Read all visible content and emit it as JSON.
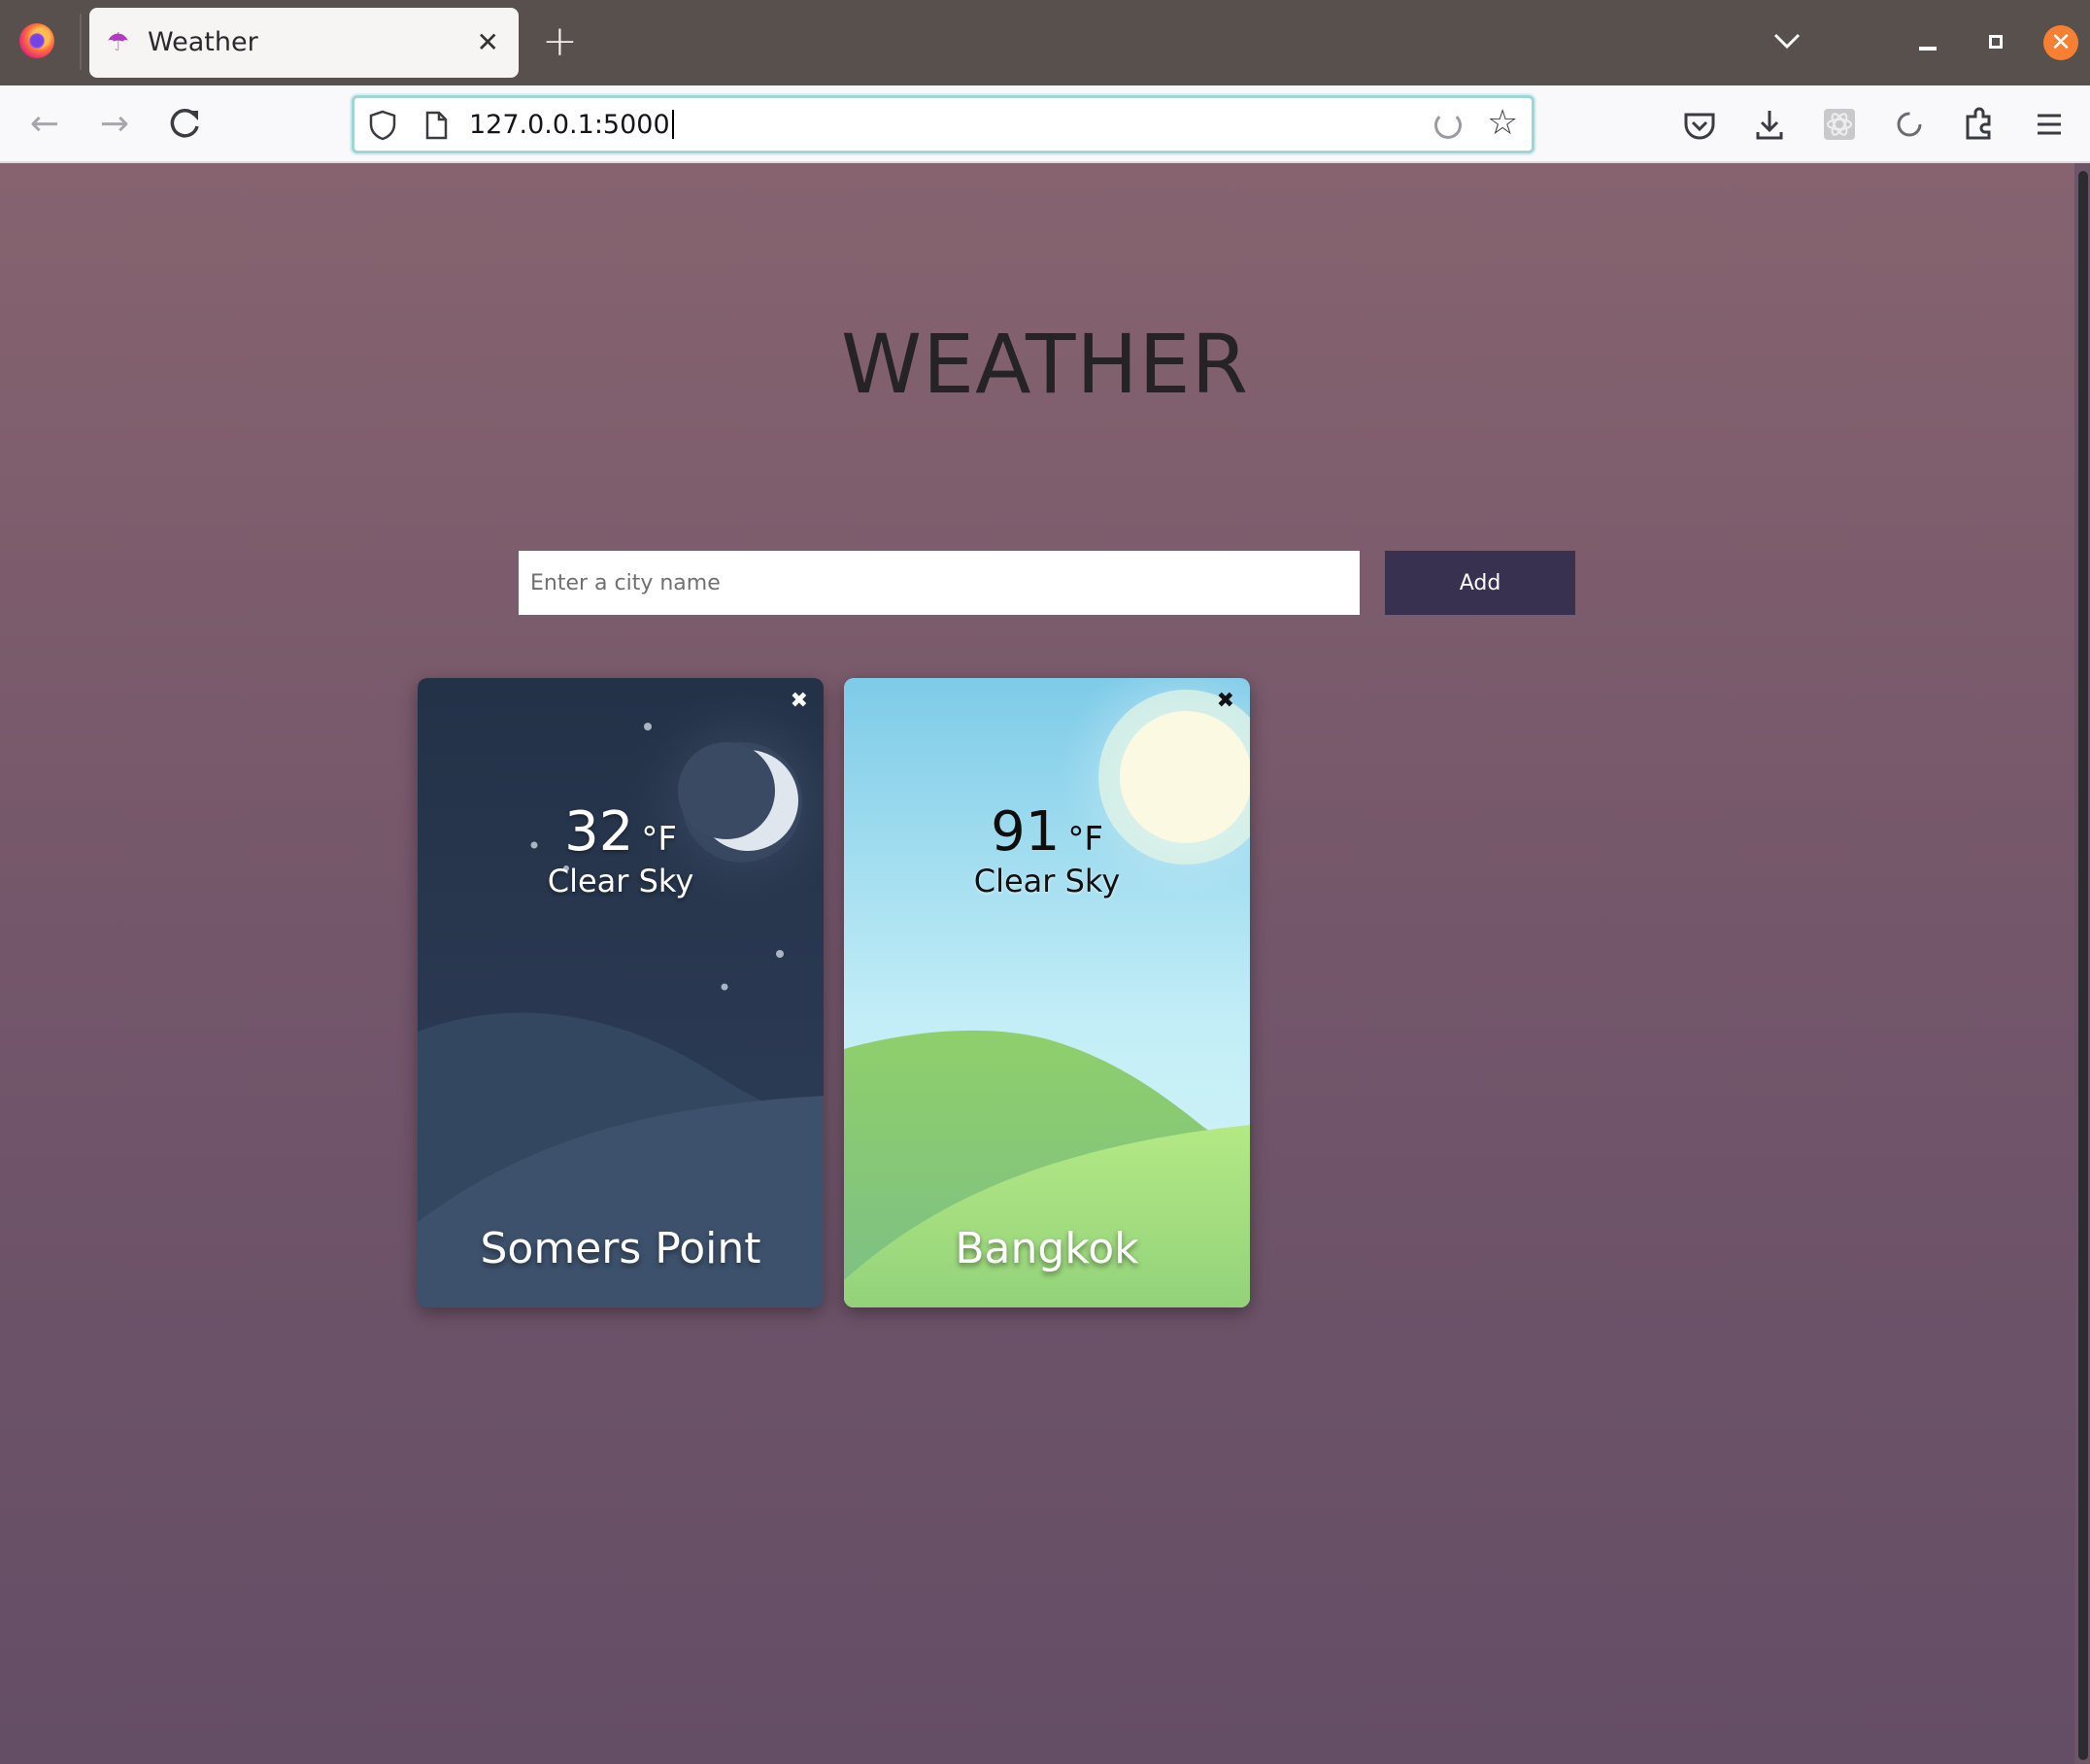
{
  "browser": {
    "tab_title": "Weather",
    "tab_icon": "umbrella-icon",
    "url": "127.0.0.1:5000",
    "accent_color": "#f77f31"
  },
  "page": {
    "title": "WEATHER",
    "search": {
      "placeholder": "Enter a city name",
      "value": "",
      "button_label": "Add",
      "button_color": "#383150"
    },
    "cards": [
      {
        "city": "Somers Point",
        "temperature": "32",
        "unit": "°F",
        "description": "Clear Sky",
        "theme": "night",
        "close_label": "✖"
      },
      {
        "city": "Bangkok",
        "temperature": "91",
        "unit": "°F",
        "description": "Clear Sky",
        "theme": "day",
        "close_label": "✖"
      }
    ]
  }
}
